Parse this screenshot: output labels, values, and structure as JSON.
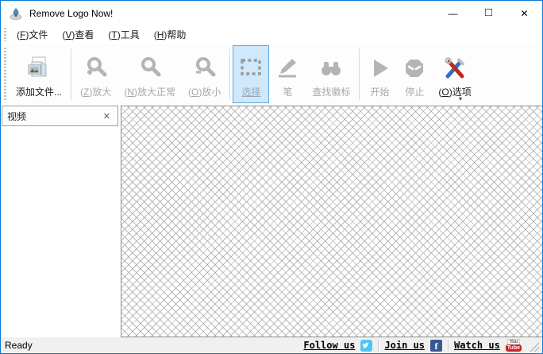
{
  "window": {
    "title": "Remove Logo Now!",
    "controls": {
      "minimize": "—",
      "maximize": "□",
      "close": "✕"
    }
  },
  "menu": {
    "items": [
      {
        "pre": "(",
        "key": "F",
        "post": ")文件"
      },
      {
        "pre": "(",
        "key": "V",
        "post": ")查看"
      },
      {
        "pre": "(",
        "key": "T",
        "post": ")工具"
      },
      {
        "pre": "(",
        "key": "H",
        "post": ")帮助"
      }
    ]
  },
  "toolbar": {
    "add_files": {
      "label": "添加文件..."
    },
    "zoom_in": {
      "pre": "(",
      "key": "Z",
      "post": ")放大"
    },
    "zoom_normal": {
      "pre": "(",
      "key": "N",
      "post": ")放大正常"
    },
    "zoom_out": {
      "pre": "(",
      "key": "O",
      "post": ")放小"
    },
    "select": {
      "label": "选择"
    },
    "pen": {
      "label": "笔"
    },
    "find_logo": {
      "label": "查找徽标"
    },
    "start": {
      "label": "开始"
    },
    "stop": {
      "label": "停止"
    },
    "options": {
      "pre": "(",
      "key": "O",
      "post": ")选项"
    },
    "overflow": "▾"
  },
  "side_panel": {
    "title": "视频",
    "close": "✕"
  },
  "status": {
    "ready": "Ready",
    "follow": "Follow us",
    "join": "Join us",
    "watch": "Watch us",
    "youtube_top": "You",
    "youtube_bottom": "Tube",
    "facebook_letter": "f"
  },
  "colors": {
    "accent_border": "#0a7ad4",
    "select_button_bg": "#cfe8fc",
    "select_button_border": "#5ea9e2",
    "disabled_text": "#a8a8a8",
    "twitter_blue": "#53c4f1",
    "facebook_blue": "#3a5795",
    "youtube_red": "#cc2128"
  }
}
